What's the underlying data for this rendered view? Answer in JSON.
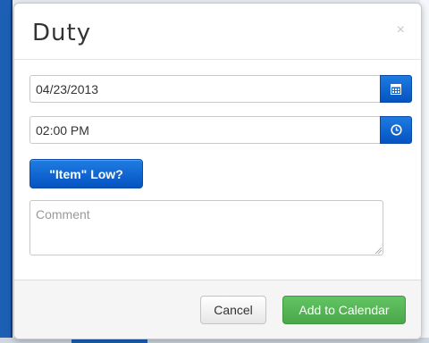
{
  "modal": {
    "title": "Duty",
    "close_label": "×"
  },
  "form": {
    "date_value": "04/23/2013",
    "date_icon": "calendar-icon",
    "time_value": "02:00 PM",
    "time_icon": "clock-icon",
    "low_button_label": "\"Item\" Low?",
    "comment_placeholder": "Comment"
  },
  "footer": {
    "cancel_label": "Cancel",
    "add_label": "Add to Calendar"
  },
  "colors": {
    "primary": "#0553c3",
    "success": "#4aa74a"
  }
}
